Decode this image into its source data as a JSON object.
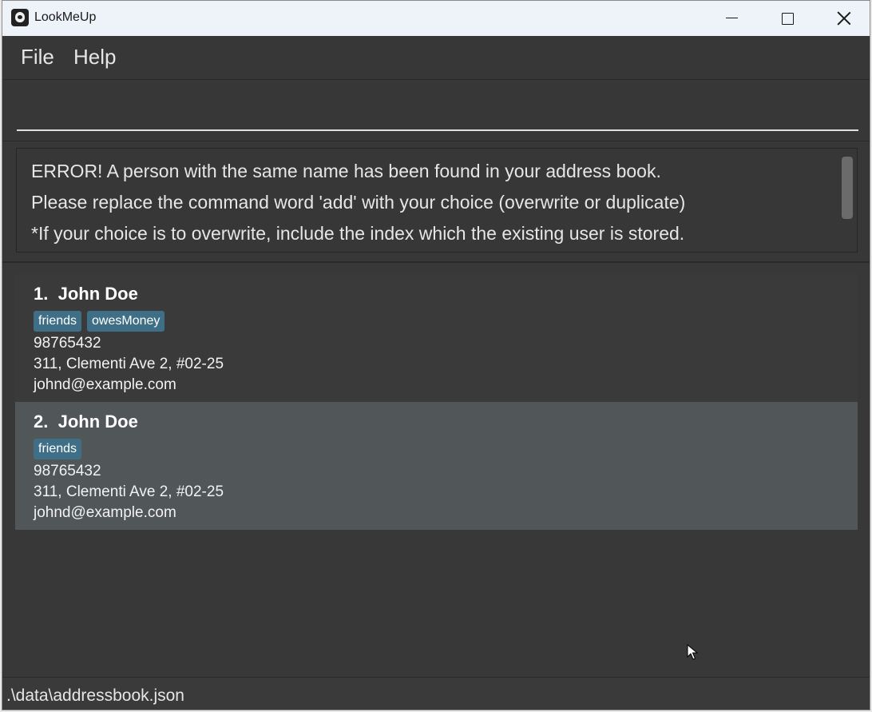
{
  "window": {
    "title": "LookMeUp"
  },
  "menu": {
    "file": "File",
    "help": "Help"
  },
  "command": {
    "value": "",
    "placeholder": ""
  },
  "result": {
    "lines": [
      "ERROR! A person with the same name has been found in your address book.",
      "Please replace the command word 'add' with your choice (overwrite or duplicate)",
      "*If your choice is to overwrite, include the index which the existing user is stored."
    ]
  },
  "persons": [
    {
      "index": "1.",
      "name": "John Doe",
      "tags": [
        "friends",
        "owesMoney"
      ],
      "phone": "98765432",
      "address": "311, Clementi Ave 2, #02-25",
      "email": "johnd@example.com"
    },
    {
      "index": "2.",
      "name": "John Doe",
      "tags": [
        "friends"
      ],
      "phone": "98765432",
      "address": "311, Clementi Ave 2, #02-25",
      "email": "johnd@example.com"
    }
  ],
  "status": {
    "path": ".\\data\\addressbook.json"
  },
  "colors": {
    "background": "#383838",
    "selected_card": "#515658",
    "tag": "#3f6f86"
  }
}
